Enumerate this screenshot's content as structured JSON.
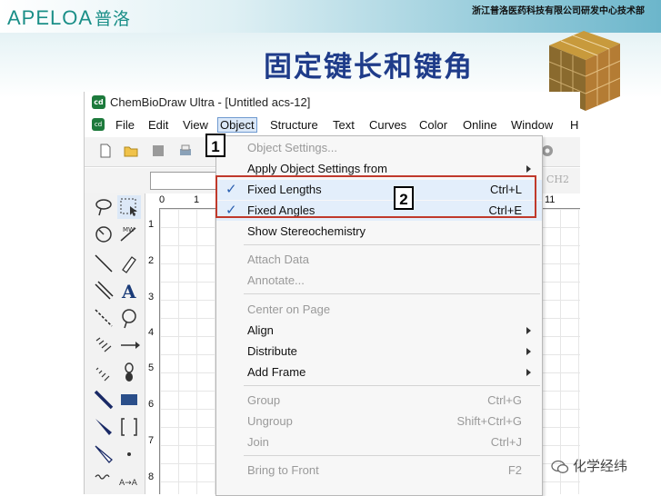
{
  "slide": {
    "logo_latin": "APELOA",
    "logo_cn": "普洛",
    "company": "浙江普洛医药科技有限公司研发中心技术部",
    "title": "固定键长和键角",
    "watermark": "化学经纬"
  },
  "window": {
    "title": "ChemBioDraw Ultra - [Untitled acs-12]",
    "menu": [
      "File",
      "Edit",
      "View",
      "Object",
      "Structure",
      "Text",
      "Curves",
      "Color",
      "Online",
      "Window",
      "H"
    ],
    "active_menu": "Object",
    "toolbar_text": "CH2"
  },
  "ruler": {
    "top": [
      "0",
      "1",
      "11"
    ],
    "left": [
      "1",
      "2",
      "3",
      "4",
      "5",
      "6",
      "7",
      "8"
    ]
  },
  "dropdown": {
    "items": [
      {
        "label": "Object Settings...",
        "shortcut": "",
        "disabled": true,
        "submenu": false,
        "checked": false
      },
      {
        "label": "Apply Object Settings from",
        "shortcut": "",
        "disabled": false,
        "submenu": true,
        "checked": false
      },
      {
        "label": "Fixed Lengths",
        "shortcut": "Ctrl+L",
        "disabled": false,
        "submenu": false,
        "checked": true
      },
      {
        "label": "Fixed Angles",
        "shortcut": "Ctrl+E",
        "disabled": false,
        "submenu": false,
        "checked": true
      },
      {
        "label": "Show Stereochemistry",
        "shortcut": "",
        "disabled": false,
        "submenu": false,
        "checked": false
      },
      {
        "label": "Attach Data",
        "shortcut": "",
        "disabled": true,
        "submenu": false,
        "checked": false
      },
      {
        "label": "Annotate...",
        "shortcut": "",
        "disabled": true,
        "submenu": false,
        "checked": false
      },
      {
        "label": "Center on Page",
        "shortcut": "",
        "disabled": true,
        "submenu": false,
        "checked": false
      },
      {
        "label": "Align",
        "shortcut": "",
        "disabled": false,
        "submenu": true,
        "checked": false
      },
      {
        "label": "Distribute",
        "shortcut": "",
        "disabled": false,
        "submenu": true,
        "checked": false
      },
      {
        "label": "Add Frame",
        "shortcut": "",
        "disabled": false,
        "submenu": true,
        "checked": false
      },
      {
        "label": "Group",
        "shortcut": "Ctrl+G",
        "disabled": true,
        "submenu": false,
        "checked": false
      },
      {
        "label": "Ungroup",
        "shortcut": "Shift+Ctrl+G",
        "disabled": true,
        "submenu": false,
        "checked": false
      },
      {
        "label": "Join",
        "shortcut": "Ctrl+J",
        "disabled": true,
        "submenu": false,
        "checked": false
      },
      {
        "label": "Bring to Front",
        "shortcut": "F2",
        "disabled": true,
        "submenu": false,
        "checked": false
      }
    ]
  },
  "callouts": [
    "1",
    "2"
  ],
  "colors": {
    "title_blue": "#1f3c8a",
    "brand_teal": "#1b8f88",
    "highlight_red": "#c0392b",
    "check_blue": "#2a5fb0"
  }
}
